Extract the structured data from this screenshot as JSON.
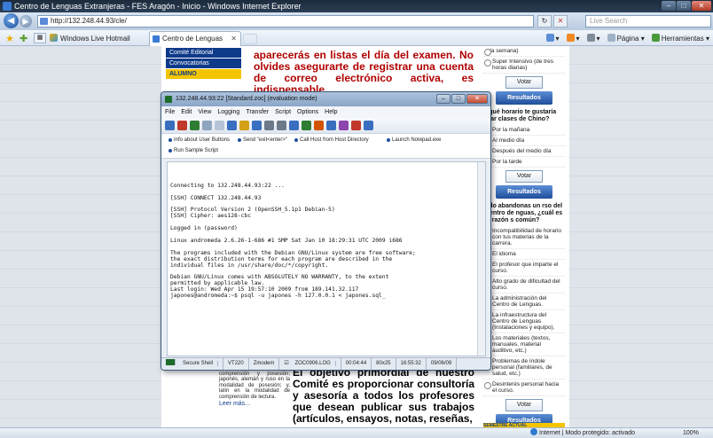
{
  "window": {
    "title": "Centro de Lenguas Extranjeras - FES Aragón - Inicio - Windows Internet Explorer",
    "min": "–",
    "max": "□",
    "close": "✕"
  },
  "address_bar": {
    "url": "http://132.248.44.93/cle/",
    "search_placeholder": "Live Search"
  },
  "favorites": {
    "link_label": "Windows Live Hotmail"
  },
  "tab": {
    "label": "Centro de Lenguas Extr...",
    "close": "✕"
  },
  "command_bar": {
    "page_label": "Página",
    "tools_label": "Herramientas"
  },
  "left_menu": {
    "items": [
      "Comité Editorial",
      "Convocatorias"
    ],
    "highlight": "ALUMNO"
  },
  "notice_text": "aparecerás en listas el día del examen. No olvides asegurarte de registrar una cuenta de correo electrónico activa, es indispensable.",
  "poll": {
    "top_option": "Super Intensivo (de tres horas diarias)",
    "top_option_fragment": "a la semana)",
    "vote_label": "Votar",
    "results_label": "Resultados",
    "q2": "¿qué horario te gustaría mar clases de Chino?",
    "q2_options": [
      "Por la mañana",
      "Al medio día",
      "Después del medio día",
      "Por la tarde"
    ],
    "q3": "ndo abandonas un rso del Centro de nguas, ¿cuál es la razón s común?",
    "q3_options": [
      "Incompatibilidad de horario con tus materias de la carrera.",
      "El idioma",
      "El profesor que imparte el curso.",
      "Alto grado de dificultad del curso.",
      "La administración del Centro de Lenguas.",
      "La infraestructura del Centro de Lenguas (Instalaciones y equipo).",
      "Los materiales (textos, manuales, material auditivo, etc.)",
      "Problemas de índole personal (familiares, de salud, etc.)",
      "Desinterés personal hacia el curso."
    ],
    "footer": "SEMESTRE ACTUAL"
  },
  "bottom_left_text": "portugués en modalidades de comprensión y posesión; japonés, alemán y ruso en la modalidad de posesión; y, latín en la modalidad de comprensión de lectura.",
  "bottom_left_more": "Leer más...",
  "bottom_big_text": "El objetivo primordial de nuestro Comité es proporcionar consultoría y asesoría a todos los profesores que desean publicar sus trabajos (artículos, ensayos, notas, reseñas,",
  "ssh": {
    "title": "132.248.44.93:22 [Standard.zoc] (evaluation mode)",
    "menu": [
      "File",
      "Edit",
      "View",
      "Logging",
      "Transfer",
      "Script",
      "Options",
      "Help"
    ],
    "buttons": [
      "Info about User Buttons",
      "Send \"exit<enter>\"",
      "Call Host from Host Directory",
      "Launch Notepad.exe",
      "Run Sample Script"
    ],
    "terminal_lines": [
      "Connecting to 132.248.44.93:22 ...",
      "",
      "[SSH] CONNECT 132.248.44.93",
      "",
      "[SSH] Protocol Version 2 (OpenSSH_5.1p1 Debian-5)",
      "[SSH] Cipher: aes128-cbc",
      "",
      "Logged in (password)",
      "",
      "Linux andromeda 2.6.26-1-686 #1 SMP Sat Jan 10 18:29:31 UTC 2009 i686",
      "",
      "The programs included with the Debian GNU/Linux system are free software;",
      "the exact distribution terms for each program are described in the",
      "individual files in /usr/share/doc/*/copyright.",
      "",
      "Debian GNU/Linux comes with ABSOLUTELY NO WARRANTY, to the extent",
      "permitted by applicable law.",
      "Last login: Wed Apr 15 19:57:10 2009 from 189.141.32.117",
      "japones@andromeda:~$ psql -u japones -h 127.0.0.1 < japones.sql_"
    ],
    "status": [
      "Secure Shell",
      "VT220",
      "Zmodem",
      "ZOC0906.LOG",
      "00:04:44",
      "80x25",
      "16:55:32",
      "09/06/09"
    ]
  },
  "ie_status": {
    "zone": "Internet | Modo protegido: activado",
    "zoom": "100%"
  }
}
